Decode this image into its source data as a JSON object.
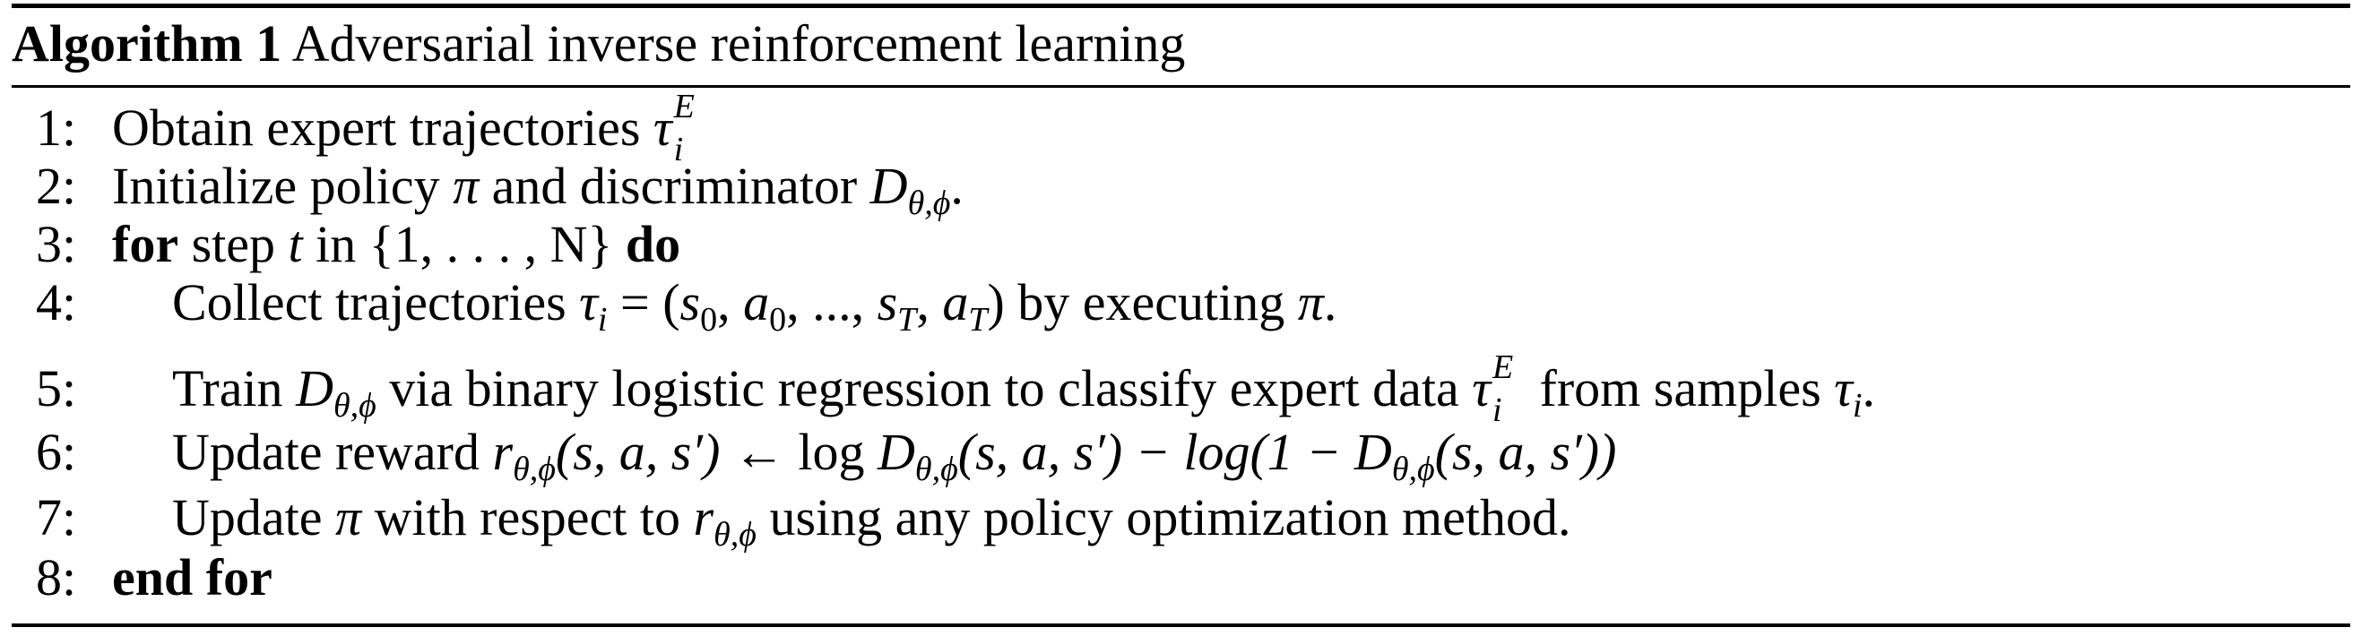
{
  "algorithm": {
    "label": "Algorithm 1",
    "title": "Adversarial inverse reinforcement learning"
  },
  "lines": [
    {
      "num": "1:",
      "text_a": "Obtain expert trajectories ",
      "tau": "τ",
      "sub": "i",
      "sup": "E"
    },
    {
      "num": "2:",
      "text_a": "Initialize policy ",
      "pi": "π",
      "text_b": " and discriminator ",
      "D": "D",
      "Dsub": "θ,ϕ",
      "text_c": "."
    },
    {
      "num": "3:",
      "kw_for": "for",
      "text_a": " step ",
      "t": "t",
      "text_b": " in ",
      "set": "{1, . . . , N}",
      "kw_do": "do"
    },
    {
      "num": "4:",
      "text_a": "Collect trajectories ",
      "tau": "τ",
      "sub": "i",
      "eq": " = (",
      "s0": "s",
      "s0sub": "0",
      "a0": "a",
      "a0sub": "0",
      "dots": ", ..., ",
      "sT": "s",
      "sTsub": "T",
      "aT": "a",
      "aTsub": "T",
      "close": ")",
      "text_b": " by executing ",
      "pi": "π",
      "text_c": "."
    },
    {
      "num": "5:",
      "text_a": "Train ",
      "D": "D",
      "Dsub": "θ,ϕ",
      "text_b": " via binary logistic regression to classify expert data ",
      "tau": "τ",
      "sub": "i",
      "sup": "E",
      "text_c": " from samples ",
      "tau2": "τ",
      "sub2": "i",
      "text_d": "."
    },
    {
      "num": "6:",
      "text_a": "Update reward ",
      "r": "r",
      "rsub": "θ,ϕ",
      "args": "(s, a, s′)",
      "arrow": " ← log ",
      "D": "D",
      "Dsub": "θ,ϕ",
      "args2": "(s, a, s′) − log(1 − ",
      "D2": "D",
      "D2sub": "θ,ϕ",
      "args3": "(s, a, s′))"
    },
    {
      "num": "7:",
      "text_a": "Update ",
      "pi": "π",
      "text_b": " with respect to ",
      "r": "r",
      "rsub": "θ,ϕ",
      "text_c": " using any policy optimization method."
    },
    {
      "num": "8:",
      "kw_end": "end for"
    }
  ]
}
